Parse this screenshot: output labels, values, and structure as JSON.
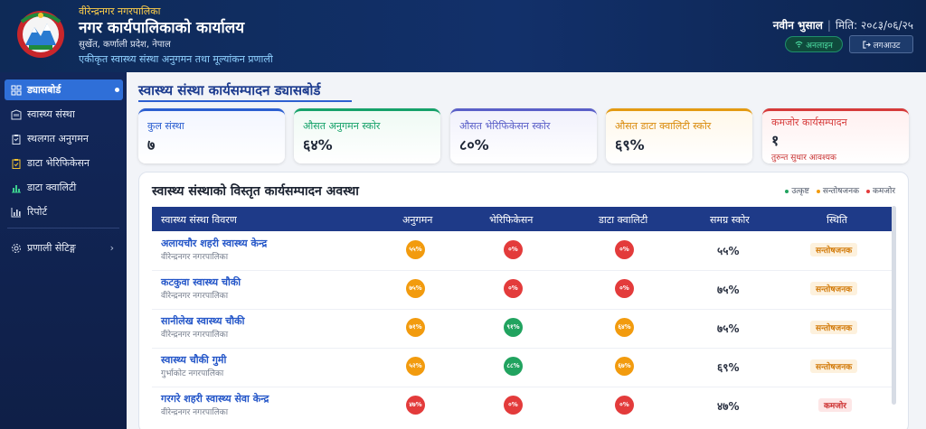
{
  "header": {
    "municipality_small": "वीरेन्द्रनगर नगरपालिका",
    "office_title": "नगर कार्यपालिकाको कार्यालय",
    "address": "सुर्खेत, कर्णाली प्रदेश, नेपाल",
    "system_name": "एकीकृत स्वास्थ्य संस्था अनुगमन तथा मूल्यांकन प्रणाली",
    "user_name": "नवीन भुसाल",
    "date_label": "मिति: २०८३/०६/२५",
    "online_label": "अनलाइन",
    "logout_label": "लगआउट"
  },
  "sidebar": {
    "items": [
      {
        "label": "ड्यासबोर्ड",
        "icon": "dashboard-icon"
      },
      {
        "label": "स्वास्थ्य संस्था",
        "icon": "building-icon"
      },
      {
        "label": "स्थलगत अनुगमन",
        "icon": "clipboard-icon"
      },
      {
        "label": "डाटा भेरिफिकेसन",
        "icon": "clipboard-check-icon"
      },
      {
        "label": "डाटा क्वालिटी",
        "icon": "bar-chart-icon"
      },
      {
        "label": "रिपोर्ट",
        "icon": "report-chart-icon"
      }
    ],
    "settings_label": "प्रणाली सेटिङ्ग"
  },
  "main": {
    "page_title": "स्वास्थ्य संस्था कार्यसम्पादन ड्यासबोर्ड",
    "cards": [
      {
        "label": "कुल संस्था",
        "value": "७",
        "color": "#2c5fd1"
      },
      {
        "label": "औसत अनुगमन स्कोर",
        "value": "६४%",
        "color": "#16a26a"
      },
      {
        "label": "औसत भेरिफिकेसन स्कोर",
        "value": "८०%",
        "color": "#5a5fc8"
      },
      {
        "label": "औसत डाटा क्वालिटी स्कोर",
        "value": "६९%",
        "color": "#e39a12"
      },
      {
        "label": "कमजोर कार्यसम्पादन",
        "value": "१",
        "note": "तुरुन्त सुधार आवश्यक",
        "color": "#d63a3a"
      }
    ],
    "table": {
      "title": "स्वास्थ्य संस्थाको विस्तृत कार्यसम्पादन अवस्था",
      "legend": [
        "उत्कृष्ट",
        "सन्तोषजनक",
        "कमजोर"
      ],
      "columns": [
        "स्वास्थ्य संस्था विवरण",
        "अनुगमन",
        "भेरिफिकेसन",
        "डाटा क्वालिटी",
        "समग्र स्कोर",
        "स्थिति"
      ],
      "rows": [
        {
          "name": "अलायचौर शहरी स्वास्थ्य केन्द्र",
          "sub": "वीरेन्द्रनगर नगरपालिका",
          "anugaman": "५५%",
          "verification": "०%",
          "quality": "०%",
          "overall": "५५%",
          "status": "सन्तोषजनक"
        },
        {
          "name": "कटकुवा स्वास्थ्य चौकी",
          "sub": "वीरेन्द्रनगर नगरपालिका",
          "anugaman": "७५%",
          "verification": "०%",
          "quality": "०%",
          "overall": "७५%",
          "status": "सन्तोषजनक"
        },
        {
          "name": "सानीलेख स्वास्थ्य चौकी",
          "sub": "वीरेन्द्रनगर नगरपालिका",
          "anugaman": "७१%",
          "verification": "९१%",
          "quality": "६४%",
          "overall": "७५%",
          "status": "सन्तोषजनक"
        },
        {
          "name": "स्वास्थ्य चौकी गुमी",
          "sub": "गुर्भाकोट नगरपालिका",
          "anugaman": "५२%",
          "verification": "८८%",
          "quality": "६७%",
          "overall": "६९%",
          "status": "सन्तोषजनक"
        },
        {
          "name": "गरगरे शहरी स्वास्थ्य सेवा केन्द्र",
          "sub": "वीरेन्द्रनगर नगरपालिका",
          "anugaman": "४७%",
          "verification": "०%",
          "quality": "०%",
          "overall": "४७%",
          "status": "कमजोर"
        }
      ]
    }
  }
}
